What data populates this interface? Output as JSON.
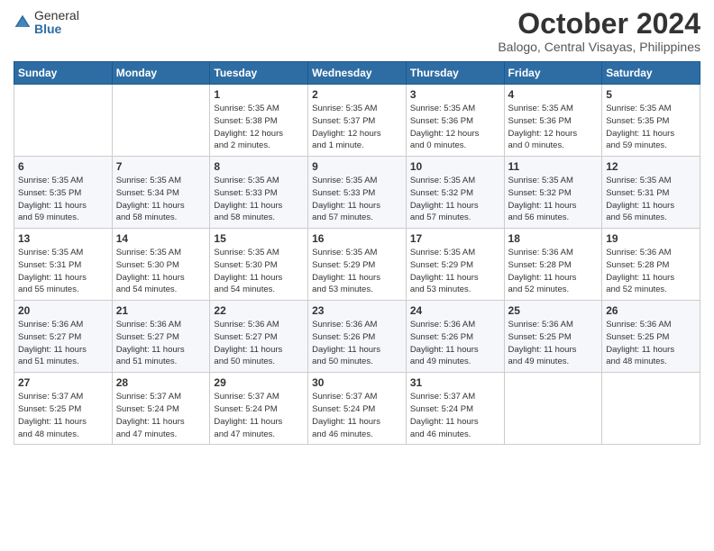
{
  "header": {
    "logo_general": "General",
    "logo_blue": "Blue",
    "month_title": "October 2024",
    "subtitle": "Balogo, Central Visayas, Philippines"
  },
  "days_of_week": [
    "Sunday",
    "Monday",
    "Tuesday",
    "Wednesday",
    "Thursday",
    "Friday",
    "Saturday"
  ],
  "weeks": [
    [
      {
        "day": "",
        "info": ""
      },
      {
        "day": "",
        "info": ""
      },
      {
        "day": "1",
        "info": "Sunrise: 5:35 AM\nSunset: 5:38 PM\nDaylight: 12 hours\nand 2 minutes."
      },
      {
        "day": "2",
        "info": "Sunrise: 5:35 AM\nSunset: 5:37 PM\nDaylight: 12 hours\nand 1 minute."
      },
      {
        "day": "3",
        "info": "Sunrise: 5:35 AM\nSunset: 5:36 PM\nDaylight: 12 hours\nand 0 minutes."
      },
      {
        "day": "4",
        "info": "Sunrise: 5:35 AM\nSunset: 5:36 PM\nDaylight: 12 hours\nand 0 minutes."
      },
      {
        "day": "5",
        "info": "Sunrise: 5:35 AM\nSunset: 5:35 PM\nDaylight: 11 hours\nand 59 minutes."
      }
    ],
    [
      {
        "day": "6",
        "info": "Sunrise: 5:35 AM\nSunset: 5:35 PM\nDaylight: 11 hours\nand 59 minutes."
      },
      {
        "day": "7",
        "info": "Sunrise: 5:35 AM\nSunset: 5:34 PM\nDaylight: 11 hours\nand 58 minutes."
      },
      {
        "day": "8",
        "info": "Sunrise: 5:35 AM\nSunset: 5:33 PM\nDaylight: 11 hours\nand 58 minutes."
      },
      {
        "day": "9",
        "info": "Sunrise: 5:35 AM\nSunset: 5:33 PM\nDaylight: 11 hours\nand 57 minutes."
      },
      {
        "day": "10",
        "info": "Sunrise: 5:35 AM\nSunset: 5:32 PM\nDaylight: 11 hours\nand 57 minutes."
      },
      {
        "day": "11",
        "info": "Sunrise: 5:35 AM\nSunset: 5:32 PM\nDaylight: 11 hours\nand 56 minutes."
      },
      {
        "day": "12",
        "info": "Sunrise: 5:35 AM\nSunset: 5:31 PM\nDaylight: 11 hours\nand 56 minutes."
      }
    ],
    [
      {
        "day": "13",
        "info": "Sunrise: 5:35 AM\nSunset: 5:31 PM\nDaylight: 11 hours\nand 55 minutes."
      },
      {
        "day": "14",
        "info": "Sunrise: 5:35 AM\nSunset: 5:30 PM\nDaylight: 11 hours\nand 54 minutes."
      },
      {
        "day": "15",
        "info": "Sunrise: 5:35 AM\nSunset: 5:30 PM\nDaylight: 11 hours\nand 54 minutes."
      },
      {
        "day": "16",
        "info": "Sunrise: 5:35 AM\nSunset: 5:29 PM\nDaylight: 11 hours\nand 53 minutes."
      },
      {
        "day": "17",
        "info": "Sunrise: 5:35 AM\nSunset: 5:29 PM\nDaylight: 11 hours\nand 53 minutes."
      },
      {
        "day": "18",
        "info": "Sunrise: 5:36 AM\nSunset: 5:28 PM\nDaylight: 11 hours\nand 52 minutes."
      },
      {
        "day": "19",
        "info": "Sunrise: 5:36 AM\nSunset: 5:28 PM\nDaylight: 11 hours\nand 52 minutes."
      }
    ],
    [
      {
        "day": "20",
        "info": "Sunrise: 5:36 AM\nSunset: 5:27 PM\nDaylight: 11 hours\nand 51 minutes."
      },
      {
        "day": "21",
        "info": "Sunrise: 5:36 AM\nSunset: 5:27 PM\nDaylight: 11 hours\nand 51 minutes."
      },
      {
        "day": "22",
        "info": "Sunrise: 5:36 AM\nSunset: 5:27 PM\nDaylight: 11 hours\nand 50 minutes."
      },
      {
        "day": "23",
        "info": "Sunrise: 5:36 AM\nSunset: 5:26 PM\nDaylight: 11 hours\nand 50 minutes."
      },
      {
        "day": "24",
        "info": "Sunrise: 5:36 AM\nSunset: 5:26 PM\nDaylight: 11 hours\nand 49 minutes."
      },
      {
        "day": "25",
        "info": "Sunrise: 5:36 AM\nSunset: 5:25 PM\nDaylight: 11 hours\nand 49 minutes."
      },
      {
        "day": "26",
        "info": "Sunrise: 5:36 AM\nSunset: 5:25 PM\nDaylight: 11 hours\nand 48 minutes."
      }
    ],
    [
      {
        "day": "27",
        "info": "Sunrise: 5:37 AM\nSunset: 5:25 PM\nDaylight: 11 hours\nand 48 minutes."
      },
      {
        "day": "28",
        "info": "Sunrise: 5:37 AM\nSunset: 5:24 PM\nDaylight: 11 hours\nand 47 minutes."
      },
      {
        "day": "29",
        "info": "Sunrise: 5:37 AM\nSunset: 5:24 PM\nDaylight: 11 hours\nand 47 minutes."
      },
      {
        "day": "30",
        "info": "Sunrise: 5:37 AM\nSunset: 5:24 PM\nDaylight: 11 hours\nand 46 minutes."
      },
      {
        "day": "31",
        "info": "Sunrise: 5:37 AM\nSunset: 5:24 PM\nDaylight: 11 hours\nand 46 minutes."
      },
      {
        "day": "",
        "info": ""
      },
      {
        "day": "",
        "info": ""
      }
    ]
  ]
}
